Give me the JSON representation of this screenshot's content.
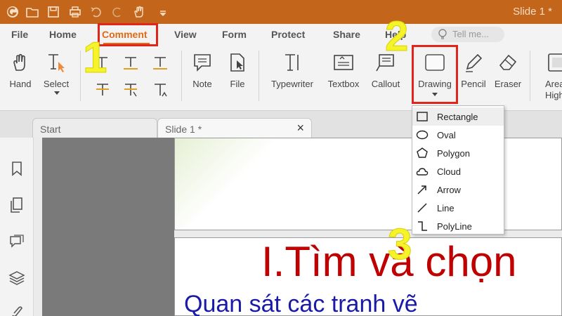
{
  "title_bar": {
    "document_title": "Slide 1 *",
    "icons": [
      "app-logo-icon",
      "open-folder-icon",
      "save-icon",
      "print-icon",
      "undo-icon",
      "redo-icon",
      "hand-icon",
      "customize-icon"
    ]
  },
  "menu": {
    "items": [
      "File",
      "Home",
      "Comment",
      "View",
      "Form",
      "Protect",
      "Share",
      "Help"
    ],
    "active": "Comment",
    "tell_me_placeholder": "Tell me..."
  },
  "ribbon": {
    "hand": "Hand",
    "select": "Select",
    "note": "Note",
    "file": "File",
    "typewriter": "Typewriter",
    "textbox": "Textbox",
    "callout": "Callout",
    "drawing": "Drawing",
    "pencil": "Pencil",
    "eraser": "Eraser",
    "area_highlight": "Area Highligh"
  },
  "tabs": [
    "Start",
    "Slide 1 *"
  ],
  "close_glyph": "×",
  "drawing_menu": [
    {
      "label": "Rectangle",
      "icon": "rectangle-icon"
    },
    {
      "label": "Oval",
      "icon": "oval-icon"
    },
    {
      "label": "Polygon",
      "icon": "polygon-icon"
    },
    {
      "label": "Cloud",
      "icon": "cloud-icon"
    },
    {
      "label": "Arrow",
      "icon": "arrow-icon"
    },
    {
      "label": "Line",
      "icon": "line-icon"
    },
    {
      "label": "PolyLine",
      "icon": "polyline-icon"
    }
  ],
  "slide": {
    "title": "I.Tìm và chọn",
    "subtitle": "Quan sát các tranh vẽ"
  },
  "annotations": {
    "step1": "1",
    "step2": "2",
    "step3": "3"
  },
  "colors": {
    "title_bar": "#c3661b",
    "accent": "#e06a14",
    "highlight_box": "#e1251b",
    "step_number": "#f5f32a"
  }
}
